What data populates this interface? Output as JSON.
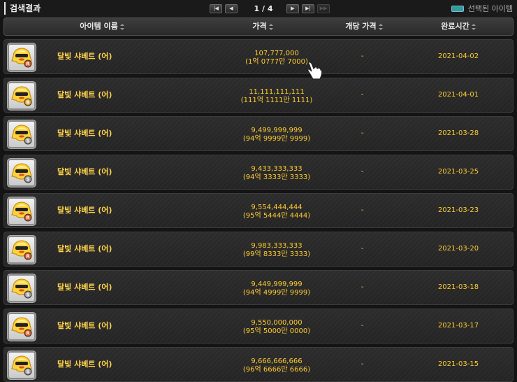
{
  "title": "검색결과",
  "pager": {
    "current": "1 / 4"
  },
  "legend_label": "선택된 아이템",
  "columns": {
    "name": "아이템 이름",
    "price": "가격",
    "unit_price": "개당 가격",
    "completed": "완료시간"
  },
  "rows": [
    {
      "name": "달빛 샤베트 (어)",
      "price": "107,777,000",
      "price_kr": "(1억 0777만 7000)",
      "unit_price": "-",
      "date": "2021-04-02",
      "badge": "R"
    },
    {
      "name": "달빛 샤베트 (어)",
      "price": "11,111,111,111",
      "price_kr": "(111억 1111만 1111)",
      "unit_price": "-",
      "date": "2021-04-01",
      "badge": "B"
    },
    {
      "name": "달빛 샤베트 (어)",
      "price": "9,499,999,999",
      "price_kr": "(94억 9999만 9999)",
      "unit_price": "-",
      "date": "2021-03-28",
      "badge": "S"
    },
    {
      "name": "달빛 샤베트 (어)",
      "price": "9,433,333,333",
      "price_kr": "(94억 3333만 3333)",
      "unit_price": "-",
      "date": "2021-03-25",
      "badge": "S"
    },
    {
      "name": "달빛 샤베트 (어)",
      "price": "9,554,444,444",
      "price_kr": "(95억 5444만 4444)",
      "unit_price": "-",
      "date": "2021-03-23",
      "badge": "R"
    },
    {
      "name": "달빛 샤베트 (어)",
      "price": "9,983,333,333",
      "price_kr": "(99억 8333만 3333)",
      "unit_price": "-",
      "date": "2021-03-20",
      "badge": "R"
    },
    {
      "name": "달빛 샤베트 (어)",
      "price": "9,449,999,999",
      "price_kr": "(94억 4999만 9999)",
      "unit_price": "-",
      "date": "2021-03-18",
      "badge": "S"
    },
    {
      "name": "달빛 샤베트 (어)",
      "price": "9,550,000,000",
      "price_kr": "(95억 5000만 0000)",
      "unit_price": "-",
      "date": "2021-03-17",
      "badge": "R"
    },
    {
      "name": "달빛 샤베트 (어)",
      "price": "9,666,666,666",
      "price_kr": "(96억 6666만 6666)",
      "unit_price": "-",
      "date": "2021-03-15",
      "badge": "S"
    }
  ],
  "colors": {
    "accent": "#ffcc33",
    "name_text": "#ffd24a",
    "badge_R": "#d9531e",
    "badge_B": "#e0a020",
    "badge_S": "#9a9a9a"
  }
}
